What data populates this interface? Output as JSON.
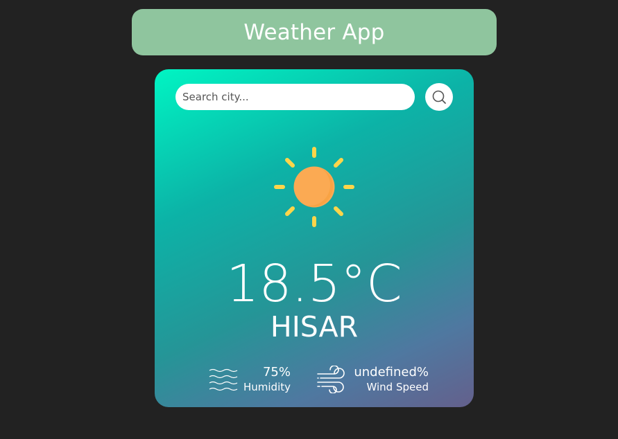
{
  "header": {
    "title": "Weather App",
    "background": "#8fc59e"
  },
  "search": {
    "placeholder": "Search city...",
    "value": "",
    "button_icon": "search-icon"
  },
  "weather": {
    "icon": "sun-icon",
    "temperature": "18.5°C",
    "city": "HISAR"
  },
  "stats": {
    "humidity": {
      "value": "75%",
      "label": "Humidity",
      "icon": "waves-icon"
    },
    "wind": {
      "value": "undefined%",
      "label": "Wind Speed",
      "icon": "wind-icon"
    }
  },
  "colors": {
    "page_background": "#222222",
    "card_gradient_start": "#00f5c3",
    "card_gradient_end": "#64608c",
    "sun_body": "#fbaa53",
    "sun_rays": "#fdd54a"
  }
}
